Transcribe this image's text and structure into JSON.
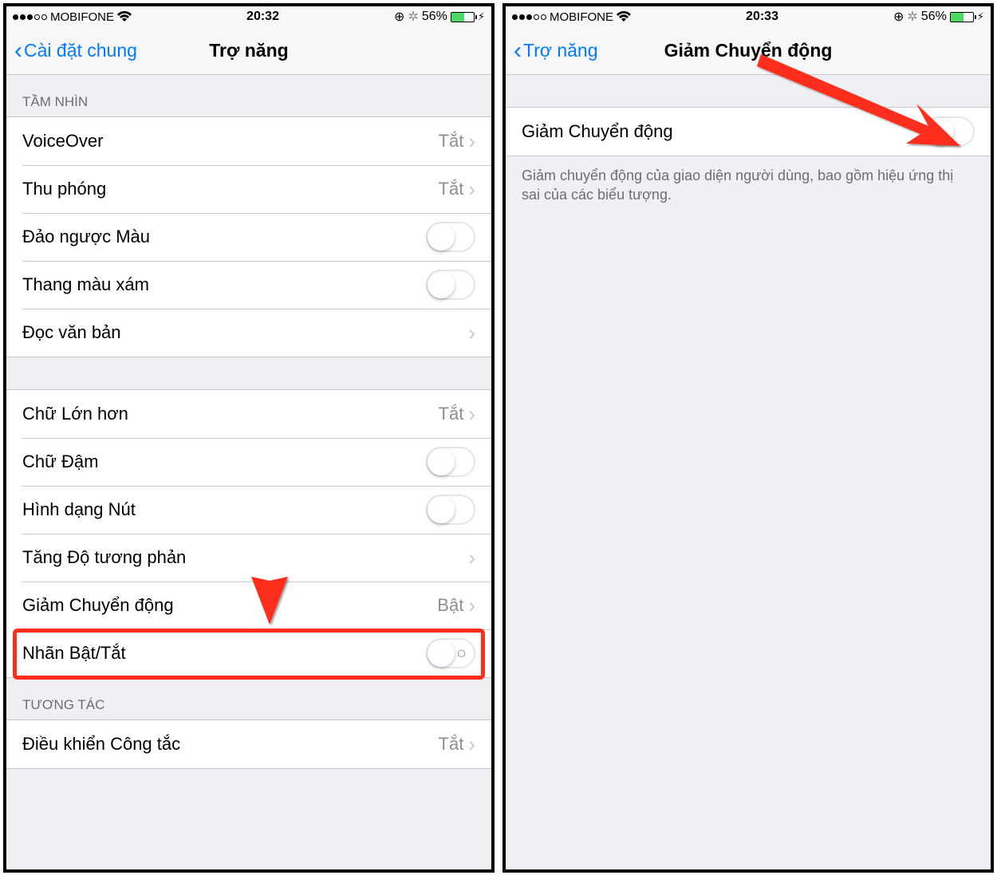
{
  "status": {
    "carrier": "MOBIFONE",
    "battery_pct": "56%",
    "battery_fill_pct": 56
  },
  "left": {
    "time": "20:32",
    "back_label": "Cài đặt chung",
    "title": "Trợ năng",
    "section_vision": "TẦM NHÌN",
    "section_interact": "TƯƠNG TÁC",
    "rows": {
      "voiceover": {
        "label": "VoiceOver",
        "value": "Tắt"
      },
      "zoom": {
        "label": "Thu phóng",
        "value": "Tắt"
      },
      "invert": {
        "label": "Đảo ngược Màu"
      },
      "grayscale": {
        "label": "Thang màu xám"
      },
      "speak": {
        "label": "Đọc văn bản"
      },
      "larger": {
        "label": "Chữ Lớn hơn",
        "value": "Tắt"
      },
      "bold": {
        "label": "Chữ Đậm"
      },
      "button_shapes": {
        "label": "Hình dạng Nút"
      },
      "contrast": {
        "label": "Tăng Độ tương phản"
      },
      "reduce_motion": {
        "label": "Giảm Chuyển động",
        "value": "Bật"
      },
      "onoff_labels": {
        "label": "Nhãn Bật/Tắt"
      },
      "switch_control": {
        "label": "Điều khiển Công tắc",
        "value": "Tắt"
      }
    }
  },
  "right": {
    "time": "20:33",
    "back_label": "Trợ năng",
    "title": "Giảm Chuyển động",
    "row_label": "Giảm Chuyển động",
    "footer": "Giảm chuyển động của giao diện người dùng, bao gồm hiệu ứng thị sai của các biểu tượng."
  }
}
